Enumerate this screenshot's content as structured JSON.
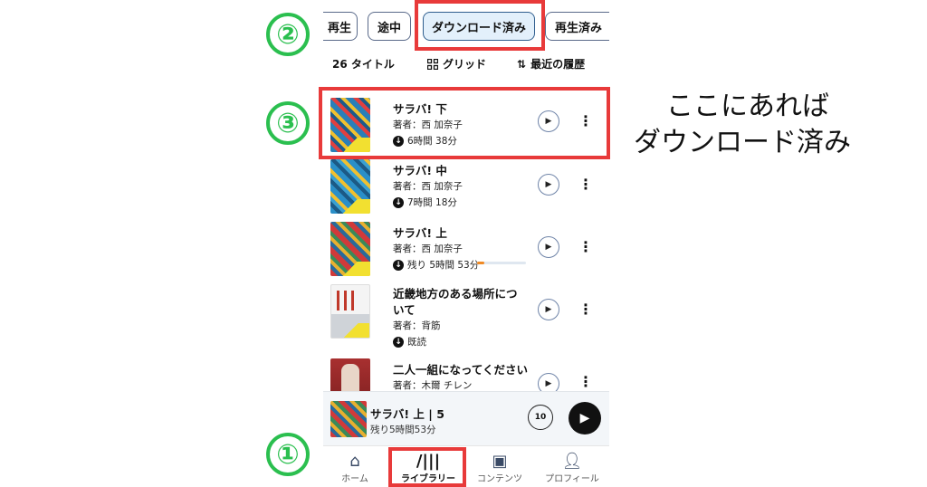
{
  "filters": {
    "chips": [
      {
        "label": "再生"
      },
      {
        "label": "途中"
      },
      {
        "label": "ダウンロード済み",
        "selected": true
      },
      {
        "label": "再生済み"
      }
    ]
  },
  "toolbar": {
    "count": "26 タイトル",
    "view_label": "グリッド",
    "sort_label": "最近の履歴"
  },
  "books": [
    {
      "title": "サラバ! 下",
      "author": "著者：西 加奈子",
      "status": "6時間 38分",
      "progress": null
    },
    {
      "title": "サラバ! 中",
      "author": "著者：西 加奈子",
      "status": "7時間 18分",
      "progress": null
    },
    {
      "title": "サラバ! 上",
      "author": "著者：西 加奈子",
      "status": "残り 5時間 53分",
      "progress": 0.15
    },
    {
      "title": "近畿地方のある場所について",
      "author": "著者：背筋",
      "status": "既読",
      "progress": null
    },
    {
      "title": "二人一組になってください",
      "author": "著者：木爾 チレン",
      "status": "",
      "progress": null
    }
  ],
  "mini_player": {
    "title": "サラバ! 上 | 5",
    "remaining": "残り5時間53分",
    "skip_label": "10"
  },
  "nav": {
    "home": "ホーム",
    "library": "ライブラリー",
    "contents": "コンテンツ",
    "profile": "プロフィール"
  },
  "annotations": {
    "num1": "①",
    "num2": "②",
    "num3": "③",
    "note_line1": "ここにあれば",
    "note_line2": "ダウンロード済み"
  },
  "colors": {
    "annotation_red": "#e83a3a",
    "annotation_green": "#2bbf4f",
    "selected_chip": "#e3f0fb",
    "progress_orange": "#f08a24"
  }
}
